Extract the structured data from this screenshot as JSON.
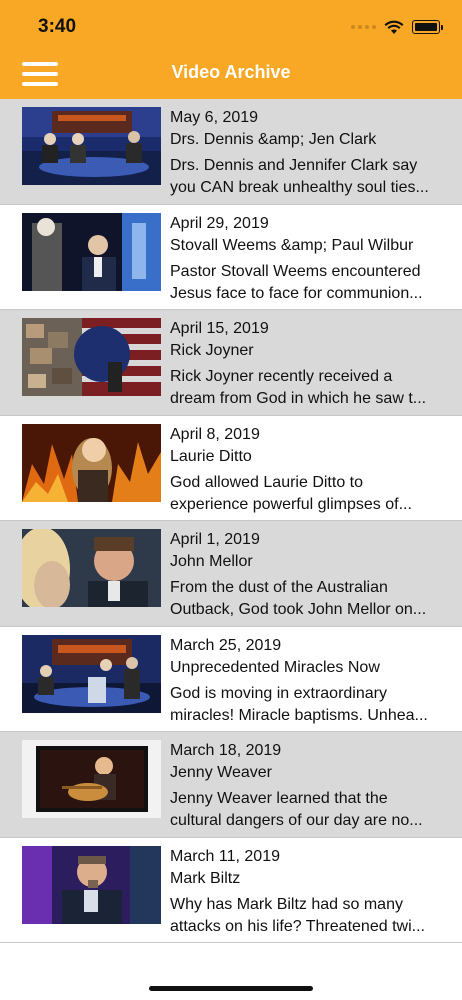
{
  "status": {
    "time": "3:40"
  },
  "header": {
    "title": "Video Archive"
  },
  "videos": [
    {
      "date": "May 6, 2019",
      "title": "Drs. Dennis &amp; Jen Clark",
      "desc1": "Drs. Dennis and Jennifer Clark say",
      "desc2": "you CAN break unhealthy soul ties..."
    },
    {
      "date": "April 29, 2019",
      "title": "Stovall Weems &amp; Paul Wilbur",
      "desc1": "Pastor Stovall Weems encountered",
      "desc2": "Jesus face to face for communion..."
    },
    {
      "date": "April 15, 2019",
      "title": "Rick Joyner",
      "desc1": "Rick Joyner recently received a",
      "desc2": "dream from God in which he saw t..."
    },
    {
      "date": "April 8, 2019",
      "title": "Laurie Ditto",
      "desc1": "God allowed Laurie Ditto to",
      "desc2": "experience powerful glimpses of..."
    },
    {
      "date": "April 1, 2019",
      "title": "John Mellor",
      "desc1": "From the dust of the Australian",
      "desc2": "Outback, God took John Mellor on..."
    },
    {
      "date": "March 25, 2019",
      "title": "Unprecedented Miracles Now",
      "desc1": "God is moving in extraordinary",
      "desc2": "miracles! Miracle baptisms. Unhea..."
    },
    {
      "date": "March 18, 2019",
      "title": "Jenny Weaver",
      "desc1": "Jenny Weaver learned that the",
      "desc2": "cultural dangers of our day are no..."
    },
    {
      "date": "March 11, 2019",
      "title": "Mark Biltz",
      "desc1": "Why has Mark Biltz had so many",
      "desc2": "attacks on his life? Threatened twi..."
    }
  ],
  "icons": {
    "menu": "hamburger-icon",
    "wifi": "wifi-icon",
    "battery": "battery-icon",
    "signal": "cellular-signal-icon"
  },
  "colors": {
    "header": "#f9a825",
    "row_alt": "#d9d9d9",
    "row": "#ffffff"
  }
}
